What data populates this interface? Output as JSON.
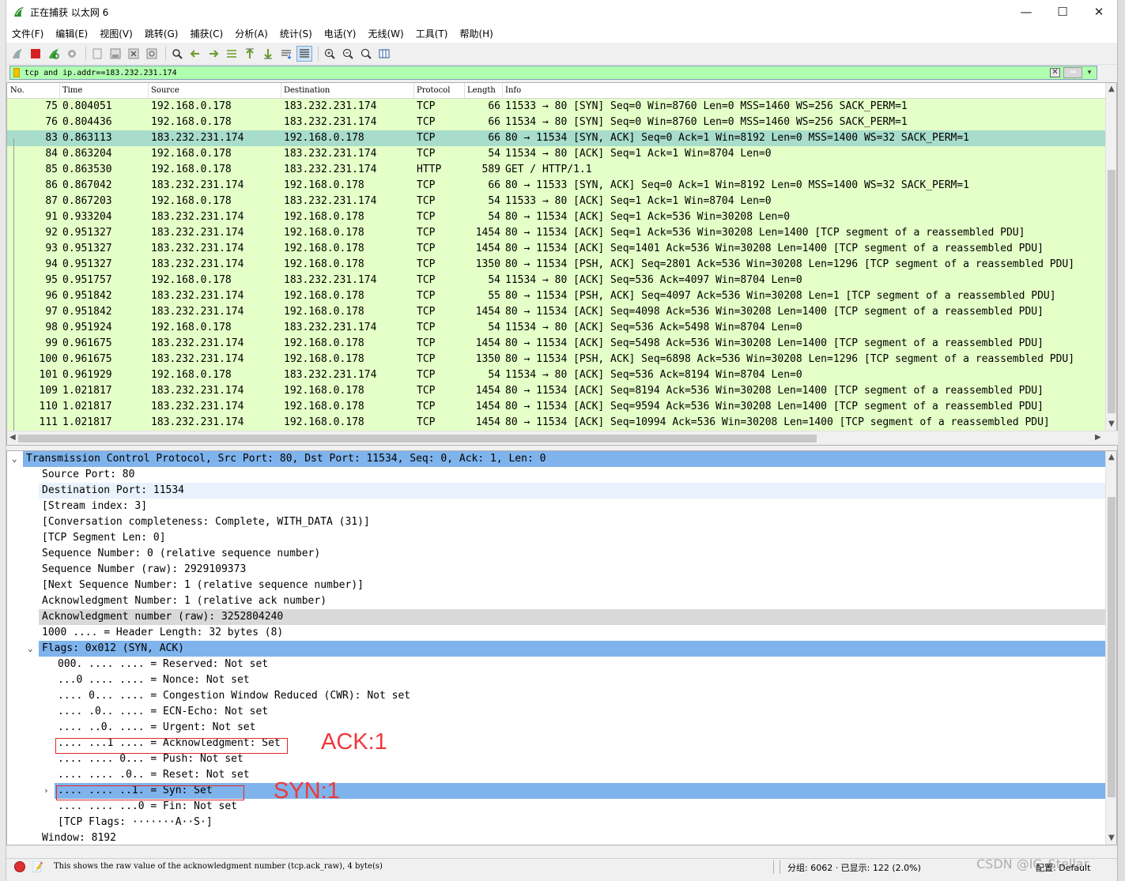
{
  "window": {
    "title": "正在捕获 以太网 6",
    "minimize": "—",
    "maximize": "☐",
    "close": "✕"
  },
  "menu": [
    "文件(F)",
    "编辑(E)",
    "视图(V)",
    "跳转(G)",
    "捕获(C)",
    "分析(A)",
    "统计(S)",
    "电话(Y)",
    "无线(W)",
    "工具(T)",
    "帮助(H)"
  ],
  "toolbar_icons": [
    "shark-fin-start-icon",
    "stop-capture-icon",
    "restart-capture-icon",
    "capture-options-icon",
    "open-file-icon",
    "save-file-icon",
    "close-file-icon",
    "reload-file-icon",
    "find-packet-icon",
    "go-back-icon",
    "go-forward-icon",
    "go-to-packet-icon",
    "first-packet-icon",
    "last-packet-icon",
    "auto-scroll-icon",
    "colorize-icon",
    "zoom-in-icon",
    "zoom-out-icon",
    "normal-size-icon",
    "resize-columns-icon"
  ],
  "filter": {
    "value": "tcp and ip.addr==183.232.231.174",
    "bg_color": "#afffaf"
  },
  "packet_list": {
    "columns": [
      "No.",
      "Time",
      "Source",
      "Destination",
      "Protocol",
      "Length",
      "Info"
    ],
    "rows": [
      {
        "no": "75",
        "time": "0.804051",
        "src": "192.168.0.178",
        "dst": "183.232.231.174",
        "proto": "TCP",
        "len": "66",
        "info": "11533 → 80 [SYN] Seq=0 Win=8760 Len=0 MSS=1460 WS=256 SACK_PERM=1"
      },
      {
        "no": "76",
        "time": "0.804436",
        "src": "192.168.0.178",
        "dst": "183.232.231.174",
        "proto": "TCP",
        "len": "66",
        "info": "11534 → 80 [SYN] Seq=0 Win=8760 Len=0 MSS=1460 WS=256 SACK_PERM=1"
      },
      {
        "no": "83",
        "time": "0.863113",
        "src": "183.232.231.174",
        "dst": "192.168.0.178",
        "proto": "TCP",
        "len": "66",
        "info": "80 → 11534 [SYN, ACK] Seq=0 Ack=1 Win=8192 Len=0 MSS=1400 WS=32 SACK_PERM=1",
        "selected": true
      },
      {
        "no": "84",
        "time": "0.863204",
        "src": "192.168.0.178",
        "dst": "183.232.231.174",
        "proto": "TCP",
        "len": "54",
        "info": "11534 → 80 [ACK] Seq=1 Ack=1 Win=8704 Len=0"
      },
      {
        "no": "85",
        "time": "0.863530",
        "src": "192.168.0.178",
        "dst": "183.232.231.174",
        "proto": "HTTP",
        "len": "589",
        "info": "GET / HTTP/1.1"
      },
      {
        "no": "86",
        "time": "0.867042",
        "src": "183.232.231.174",
        "dst": "192.168.0.178",
        "proto": "TCP",
        "len": "66",
        "info": "80 → 11533 [SYN, ACK] Seq=0 Ack=1 Win=8192 Len=0 MSS=1400 WS=32 SACK_PERM=1"
      },
      {
        "no": "87",
        "time": "0.867203",
        "src": "192.168.0.178",
        "dst": "183.232.231.174",
        "proto": "TCP",
        "len": "54",
        "info": "11533 → 80 [ACK] Seq=1 Ack=1 Win=8704 Len=0"
      },
      {
        "no": "91",
        "time": "0.933204",
        "src": "183.232.231.174",
        "dst": "192.168.0.178",
        "proto": "TCP",
        "len": "54",
        "info": "80 → 11534 [ACK] Seq=1 Ack=536 Win=30208 Len=0"
      },
      {
        "no": "92",
        "time": "0.951327",
        "src": "183.232.231.174",
        "dst": "192.168.0.178",
        "proto": "TCP",
        "len": "1454",
        "info": "80 → 11534 [ACK] Seq=1 Ack=536 Win=30208 Len=1400 [TCP segment of a reassembled PDU]"
      },
      {
        "no": "93",
        "time": "0.951327",
        "src": "183.232.231.174",
        "dst": "192.168.0.178",
        "proto": "TCP",
        "len": "1454",
        "info": "80 → 11534 [ACK] Seq=1401 Ack=536 Win=30208 Len=1400 [TCP segment of a reassembled PDU]"
      },
      {
        "no": "94",
        "time": "0.951327",
        "src": "183.232.231.174",
        "dst": "192.168.0.178",
        "proto": "TCP",
        "len": "1350",
        "info": "80 → 11534 [PSH, ACK] Seq=2801 Ack=536 Win=30208 Len=1296 [TCP segment of a reassembled PDU]"
      },
      {
        "no": "95",
        "time": "0.951757",
        "src": "192.168.0.178",
        "dst": "183.232.231.174",
        "proto": "TCP",
        "len": "54",
        "info": "11534 → 80 [ACK] Seq=536 Ack=4097 Win=8704 Len=0"
      },
      {
        "no": "96",
        "time": "0.951842",
        "src": "183.232.231.174",
        "dst": "192.168.0.178",
        "proto": "TCP",
        "len": "55",
        "info": "80 → 11534 [PSH, ACK] Seq=4097 Ack=536 Win=30208 Len=1 [TCP segment of a reassembled PDU]"
      },
      {
        "no": "97",
        "time": "0.951842",
        "src": "183.232.231.174",
        "dst": "192.168.0.178",
        "proto": "TCP",
        "len": "1454",
        "info": "80 → 11534 [ACK] Seq=4098 Ack=536 Win=30208 Len=1400 [TCP segment of a reassembled PDU]"
      },
      {
        "no": "98",
        "time": "0.951924",
        "src": "192.168.0.178",
        "dst": "183.232.231.174",
        "proto": "TCP",
        "len": "54",
        "info": "11534 → 80 [ACK] Seq=536 Ack=5498 Win=8704 Len=0"
      },
      {
        "no": "99",
        "time": "0.961675",
        "src": "183.232.231.174",
        "dst": "192.168.0.178",
        "proto": "TCP",
        "len": "1454",
        "info": "80 → 11534 [ACK] Seq=5498 Ack=536 Win=30208 Len=1400 [TCP segment of a reassembled PDU]"
      },
      {
        "no": "100",
        "time": "0.961675",
        "src": "183.232.231.174",
        "dst": "192.168.0.178",
        "proto": "TCP",
        "len": "1350",
        "info": "80 → 11534 [PSH, ACK] Seq=6898 Ack=536 Win=30208 Len=1296 [TCP segment of a reassembled PDU]"
      },
      {
        "no": "101",
        "time": "0.961929",
        "src": "192.168.0.178",
        "dst": "183.232.231.174",
        "proto": "TCP",
        "len": "54",
        "info": "11534 → 80 [ACK] Seq=536 Ack=8194 Win=8704 Len=0"
      },
      {
        "no": "109",
        "time": "1.021817",
        "src": "183.232.231.174",
        "dst": "192.168.0.178",
        "proto": "TCP",
        "len": "1454",
        "info": "80 → 11534 [ACK] Seq=8194 Ack=536 Win=30208 Len=1400 [TCP segment of a reassembled PDU]"
      },
      {
        "no": "110",
        "time": "1.021817",
        "src": "183.232.231.174",
        "dst": "192.168.0.178",
        "proto": "TCP",
        "len": "1454",
        "info": "80 → 11534 [ACK] Seq=9594 Ack=536 Win=30208 Len=1400 [TCP segment of a reassembled PDU]"
      },
      {
        "no": "111",
        "time": "1.021817",
        "src": "183.232.231.174",
        "dst": "192.168.0.178",
        "proto": "TCP",
        "len": "1454",
        "info": "80 → 11534 [ACK] Seq=10994 Ack=536 Win=30208 Len=1400 [TCP segment of a reassembled PDU]"
      }
    ],
    "row_color": "#e4ffc7",
    "selected_color": "#a8dccb"
  },
  "detail": {
    "rows": [
      {
        "text": "Transmission Control Protocol, Src Port: 80, Dst Port: 11534, Seq: 0, Ack: 1, Len: 0",
        "indent": 0,
        "expander": "expanded",
        "hl": "blue"
      },
      {
        "text": "Source Port: 80",
        "indent": 1
      },
      {
        "text": "Destination Port: 11534",
        "indent": 1,
        "hl": "light"
      },
      {
        "text": "[Stream index: 3]",
        "indent": 1
      },
      {
        "text": "[Conversation completeness: Complete, WITH_DATA (31)]",
        "indent": 1
      },
      {
        "text": "[TCP Segment Len: 0]",
        "indent": 1
      },
      {
        "text": "Sequence Number: 0    (relative sequence number)",
        "indent": 1
      },
      {
        "text": "Sequence Number (raw): 2929109373",
        "indent": 1
      },
      {
        "text": "[Next Sequence Number: 1    (relative sequence number)]",
        "indent": 1
      },
      {
        "text": "Acknowledgment Number: 1    (relative ack number)",
        "indent": 1
      },
      {
        "text": "Acknowledgment number (raw): 3252804240",
        "indent": 1,
        "hl": "gray"
      },
      {
        "text": "1000 .... = Header Length: 32 bytes (8)",
        "indent": 1
      },
      {
        "text": "Flags: 0x012 (SYN, ACK)",
        "indent": 1,
        "expander": "expanded",
        "hl": "blue"
      },
      {
        "text": "000. .... .... = Reserved: Not set",
        "indent": 2
      },
      {
        "text": "...0 .... .... = Nonce: Not set",
        "indent": 2
      },
      {
        "text": ".... 0... .... = Congestion Window Reduced (CWR): Not set",
        "indent": 2
      },
      {
        "text": ".... .0.. .... = ECN-Echo: Not set",
        "indent": 2
      },
      {
        "text": ".... ..0. .... = Urgent: Not set",
        "indent": 2
      },
      {
        "text": ".... ...1 .... = Acknowledgment: Set",
        "indent": 2
      },
      {
        "text": ".... .... 0... = Push: Not set",
        "indent": 2
      },
      {
        "text": ".... .... .0.. = Reset: Not set",
        "indent": 2
      },
      {
        "text": ".... .... ..1. = Syn: Set",
        "indent": 2,
        "expander": "collapsed",
        "hl": "blue"
      },
      {
        "text": ".... .... ...0 = Fin: Not set",
        "indent": 2
      },
      {
        "text": "[TCP Flags: ·······A··S·]",
        "indent": 2
      },
      {
        "text": "Window: 8192",
        "indent": 1
      }
    ],
    "annotations": {
      "ack_label": "ACK:1",
      "syn_label": "SYN:1",
      "color": "#f0383a"
    }
  },
  "status": {
    "message": "This shows the raw value of the acknowledgment number (tcp.ack_raw), 4 byte(s)",
    "counts": "分组: 6062 · 已显示: 122 (2.0%)",
    "profile": "配置: Default"
  },
  "watermark": "CSDN @IC_Stellar"
}
